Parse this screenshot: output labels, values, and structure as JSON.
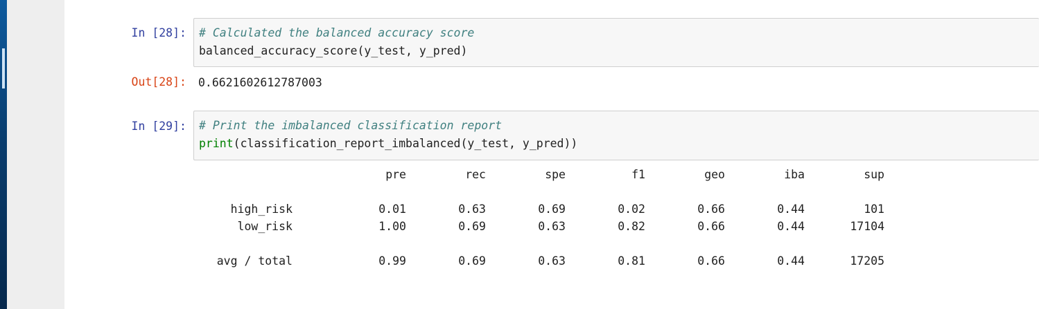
{
  "cells": {
    "in28": {
      "prompt": "In [28]:",
      "comment": "# Calculated the balanced accuracy score",
      "code": "balanced_accuracy_score(y_test, y_pred)"
    },
    "out28": {
      "prompt": "Out[28]:",
      "value": "0.6621602612787003"
    },
    "in29": {
      "prompt": "In [29]:",
      "comment": "# Print the imbalanced classification report",
      "code_builtin": "print",
      "code_rest": "(classification_report_imbalanced(y_test, y_pred))"
    }
  },
  "report": {
    "headers": [
      "pre",
      "rec",
      "spe",
      "f1",
      "geo",
      "iba",
      "sup"
    ],
    "rows": [
      {
        "label": "high_risk",
        "values": [
          "0.01",
          "0.63",
          "0.69",
          "0.02",
          "0.66",
          "0.44",
          "101"
        ]
      },
      {
        "label": "low_risk",
        "values": [
          "1.00",
          "0.69",
          "0.63",
          "0.82",
          "0.66",
          "0.44",
          "17104"
        ]
      }
    ],
    "total": {
      "label": "avg / total",
      "values": [
        "0.99",
        "0.69",
        "0.63",
        "0.81",
        "0.66",
        "0.44",
        "17205"
      ]
    }
  },
  "colors": {
    "prompt_in": "#303f9f",
    "prompt_out": "#d84315",
    "comment": "#408080",
    "builtin": "#008000"
  }
}
